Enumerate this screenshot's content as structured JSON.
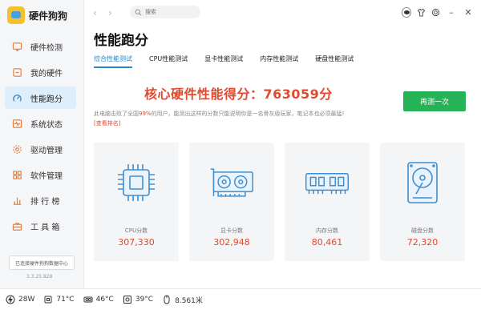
{
  "app": {
    "title": "硬件狗狗",
    "version": "3.3.25.828",
    "link_text": "已连接硬件狗狗数据中心"
  },
  "sidebar": {
    "items": [
      {
        "label": "硬件检测",
        "icon": "monitor-check-icon"
      },
      {
        "label": "我的硬件",
        "icon": "hardware-box-icon"
      },
      {
        "label": "性能跑分",
        "icon": "speed-gauge-icon",
        "active": true
      },
      {
        "label": "系统状态",
        "icon": "heartbeat-icon"
      },
      {
        "label": "驱动管理",
        "icon": "gear-icon"
      },
      {
        "label": "软件管理",
        "icon": "app-grid-icon"
      },
      {
        "label": "排 行 榜",
        "icon": "ranking-chart-icon"
      },
      {
        "label": "工 具 箱",
        "icon": "toolbox-icon"
      }
    ]
  },
  "topbar": {
    "search_placeholder": "搜索"
  },
  "page": {
    "title": "性能跑分",
    "tabs": [
      "综合性能测试",
      "CPU性能测试",
      "显卡性能测试",
      "内存性能测试",
      "硬盘性能测试"
    ],
    "active_tab": 0
  },
  "score": {
    "headline": "核心硬件性能得分：763059分",
    "desc_prefix": "此电脑击败了全国",
    "percent": "99%",
    "desc_suffix": "的用户，能测出这样的分数只能说明你是一名骨灰级玩家，笔记本也必须最猛!",
    "link": "[查看排名]",
    "retest_label": "再测一次"
  },
  "cards": [
    {
      "label": "CPU分数",
      "value": "307,330",
      "icon": "cpu-chip-icon"
    },
    {
      "label": "显卡分数",
      "value": "302,948",
      "icon": "graphics-card-icon"
    },
    {
      "label": "内存分数",
      "value": "80,461",
      "icon": "memory-stick-icon"
    },
    {
      "label": "磁盘分数",
      "value": "72,320",
      "icon": "hard-disk-icon"
    }
  ],
  "status": [
    {
      "value": "28W",
      "icon": "power-plug-icon"
    },
    {
      "value": "71°C",
      "icon": "cpu-temp-icon"
    },
    {
      "value": "46°C",
      "icon": "gpu-temp-icon"
    },
    {
      "value": "39°C",
      "icon": "board-temp-icon"
    },
    {
      "value": "8.561米",
      "icon": "mouse-distance-icon"
    }
  ],
  "colors": {
    "accent": "#2a85c9",
    "score_red": "#e24a2d",
    "button_green": "#26b256",
    "icon_blue": "#3f8fd0"
  }
}
